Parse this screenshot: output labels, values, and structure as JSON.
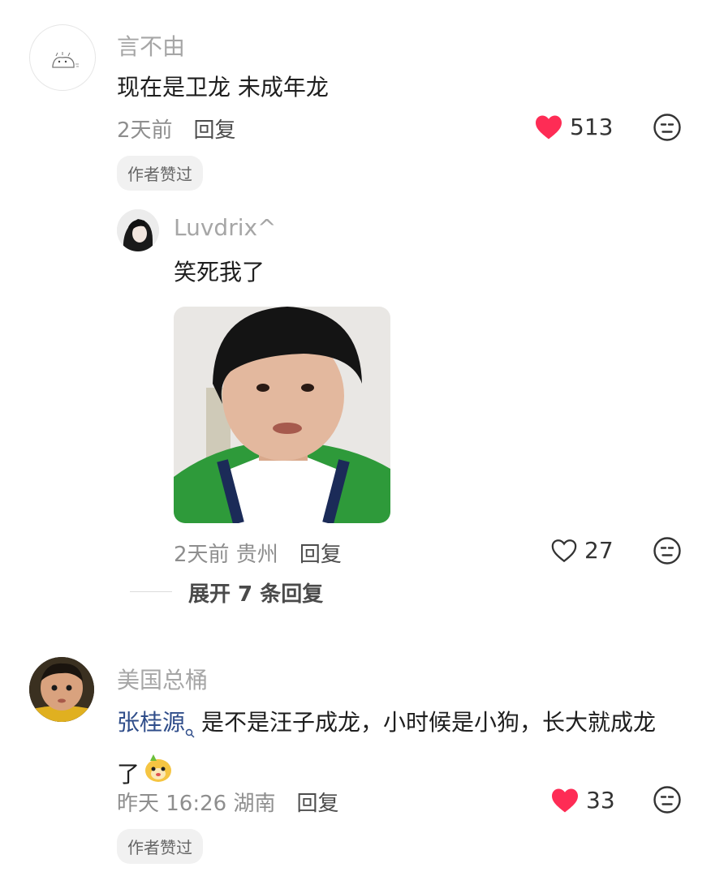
{
  "comments": [
    {
      "username": "言不由",
      "text": "现在是卫龙 未成年龙",
      "time": "2天前",
      "reply_label": "回复",
      "likes": "513",
      "liked": true,
      "badge": "作者赞过"
    },
    {
      "username": "美国总桶",
      "mention": "张桂源",
      "text": "是不是汪子成龙，小时候是小狗，长大就成龙了",
      "time": "昨天 16:26 湖南",
      "reply_label": "回复",
      "likes": "33",
      "liked": true,
      "badge": "作者赞过"
    }
  ],
  "reply": {
    "username": "Luvdrix^",
    "text": "笑死我了",
    "time": "2天前 贵州",
    "reply_label": "回复",
    "likes": "27",
    "liked": false
  },
  "expand_label": "展开 7 条回复",
  "colors": {
    "like_red": "#fe2c55",
    "mention_blue": "#2f4d8a"
  }
}
